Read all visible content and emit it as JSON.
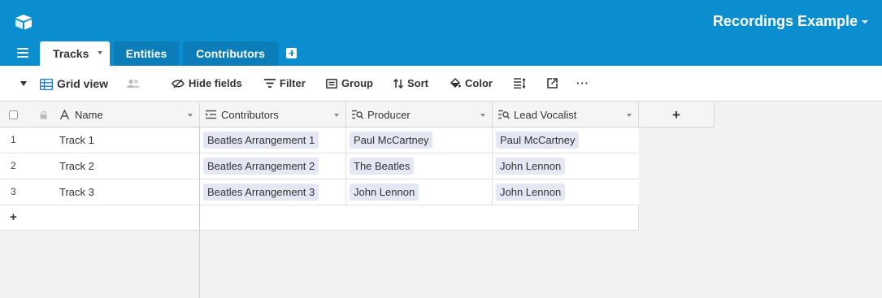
{
  "header": {
    "base_name": "Recordings Example",
    "tabs": [
      {
        "label": "Tracks"
      },
      {
        "label": "Entities"
      },
      {
        "label": "Contributors"
      }
    ]
  },
  "toolbar": {
    "view_name": "Grid view",
    "hide_fields": "Hide fields",
    "filter": "Filter",
    "group": "Group",
    "sort": "Sort",
    "color": "Color",
    "more": "···"
  },
  "grid": {
    "columns": [
      {
        "label": "Name",
        "icon": "text-field-icon"
      },
      {
        "label": "Contributors",
        "icon": "linked-record-icon"
      },
      {
        "label": "Producer",
        "icon": "lookup-icon"
      },
      {
        "label": "Lead Vocalist",
        "icon": "lookup-icon"
      }
    ],
    "add_column": "+",
    "add_row": "+",
    "rows": [
      {
        "num": "1",
        "name": "Track 1",
        "contributors": "Beatles Arrangement 1",
        "producer": "Paul McCartney",
        "lead_vocalist": "Paul McCartney"
      },
      {
        "num": "2",
        "name": "Track 2",
        "contributors": "Beatles Arrangement 2",
        "producer": "The Beatles",
        "lead_vocalist": "John Lennon"
      },
      {
        "num": "3",
        "name": "Track 3",
        "contributors": "Beatles Arrangement 3",
        "producer": "John Lennon",
        "lead_vocalist": "John Lennon"
      }
    ]
  },
  "colors": {
    "header_bg": "#0a8ecf",
    "chip_bg": "#e4e8f5"
  }
}
